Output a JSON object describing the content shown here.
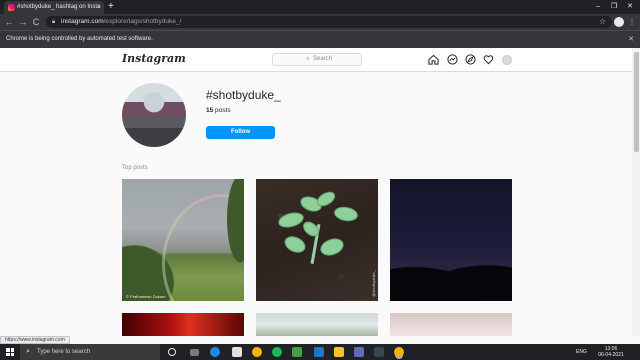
{
  "browser": {
    "tab_title": "#shotbyduke_ hashtag on Insta",
    "tab_close": "×",
    "new_tab": "+",
    "window_controls": {
      "minimize": "–",
      "maximize": "❐",
      "close": "✕"
    },
    "nav": {
      "back": "←",
      "forward": "→",
      "reload": "C"
    },
    "url_host": "instagram.com",
    "url_path": "/explore/tags/shotbyduke_/",
    "star": "☆",
    "menu": "⋮",
    "infobar_text": "Chrome is being controlled by automated test software.",
    "infobar_close": "✕"
  },
  "instagram": {
    "logo": "Instagram",
    "search_placeholder": "Search",
    "hashtag": "#shotbyduke_",
    "posts_count": "15",
    "posts_label": "posts",
    "follow_label": "Follow",
    "top_posts_label": "Top posts",
    "post1_credit": "© Prathamesh Dukare",
    "post2_credit": "@shotbyduke_"
  },
  "status_bar_url": "https://www.instagram.com",
  "taskbar": {
    "search_placeholder": "Type here to search",
    "language": "ENG",
    "time": "13:06",
    "date": "06-04-2021"
  },
  "colors": {
    "accent_blue": "#0095f6",
    "chrome_dark": "#202124",
    "chrome_toolbar": "#35363a"
  },
  "icons": [
    "search-icon",
    "home-icon",
    "messenger-icon",
    "compass-icon",
    "heart-icon",
    "lock-icon",
    "star-icon",
    "windows-start-icon"
  ]
}
